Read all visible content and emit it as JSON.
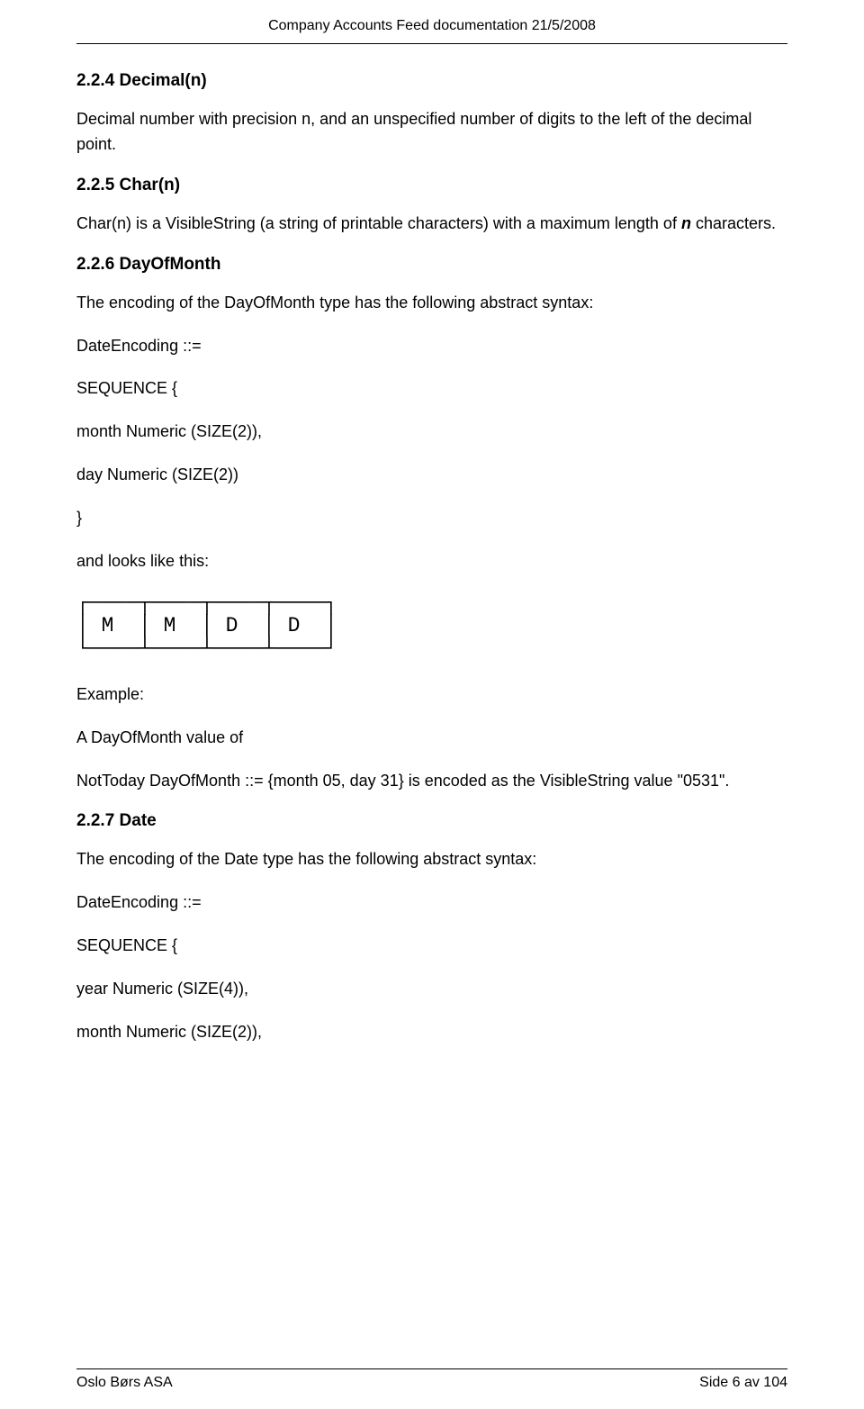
{
  "header": {
    "title": "Company Accounts Feed documentation 21/5/2008"
  },
  "sections": {
    "decimal": {
      "heading": "2.2.4 Decimal(n)",
      "body": "Decimal number with precision n, and an unspecified number of digits to the left of the decimal point."
    },
    "char": {
      "heading": "2.2.5 Char(n)",
      "body_pre": "Char(n) is a VisibleString (a string of printable characters) with a maximum length of ",
      "body_bold": "n",
      "body_post": " characters."
    },
    "dayofmonth": {
      "heading": "2.2.6 DayOfMonth",
      "intro": "The encoding of the DayOfMonth type has the following abstract syntax:",
      "line1": "DateEncoding ::=",
      "line2": "SEQUENCE {",
      "line3": "month Numeric (SIZE(2)),",
      "line4": "day Numeric (SIZE(2))",
      "line5": "}",
      "looks": "and looks like this:",
      "diagram": "┌────┬────┬────┬────┐\n│ M  │ M  │ D  │ D  │\n└────┴────┴────┴────┘",
      "example_label": "Example:",
      "example_body1": "A DayOfMonth value of",
      "example_body2": "NotToday DayOfMonth ::= {month 05, day 31} is encoded as the VisibleString value \"0531\"."
    },
    "date": {
      "heading": "2.2.7 Date",
      "intro": "The encoding of the Date type has the following abstract syntax:",
      "line1": "DateEncoding ::=",
      "line2": "SEQUENCE {",
      "line3": "year Numeric (SIZE(4)),",
      "line4": "month Numeric (SIZE(2)),"
    }
  },
  "footer": {
    "left": "Oslo Børs ASA",
    "right": "Side 6 av 104"
  }
}
